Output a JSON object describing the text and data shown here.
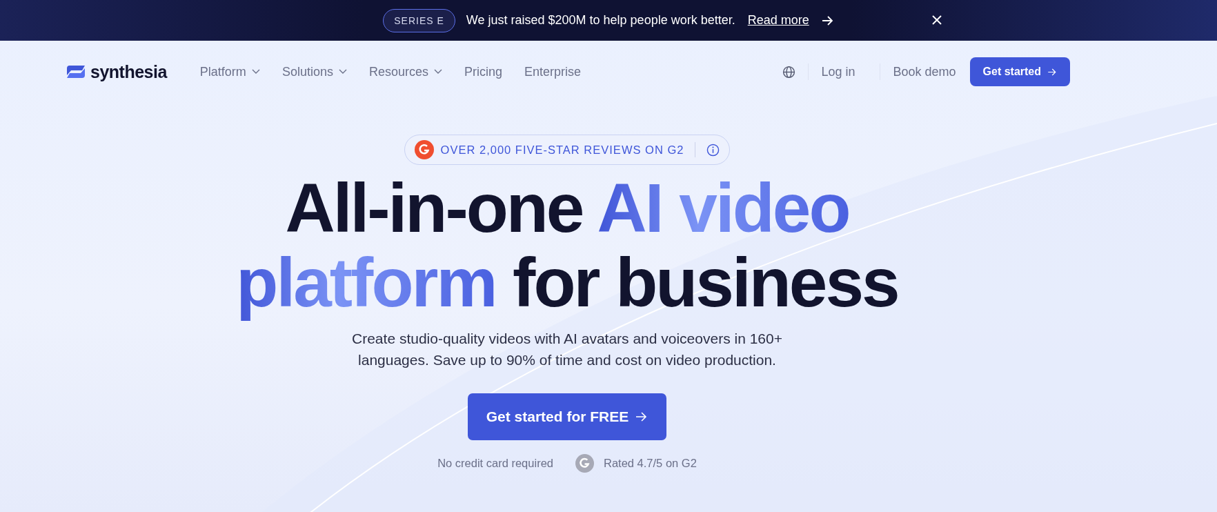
{
  "announcement": {
    "tag": "SERIES E",
    "message": "We just raised $200M to help people work better.",
    "link": "Read more"
  },
  "nav": {
    "logo": "synthesia",
    "items": [
      {
        "label": "Platform",
        "dropdown": true
      },
      {
        "label": "Solutions",
        "dropdown": true
      },
      {
        "label": "Resources",
        "dropdown": true
      },
      {
        "label": "Pricing",
        "dropdown": false
      },
      {
        "label": "Enterprise",
        "dropdown": false
      }
    ],
    "login": "Log in",
    "demo": "Book demo",
    "cta": "Get started"
  },
  "hero": {
    "badge": "OVER 2,000 FIVE-STAR REVIEWS ON G2",
    "headline": [
      [
        {
          "text": "All-in-one ",
          "highlight": false
        },
        {
          "text": "AI video",
          "highlight": true
        }
      ],
      [
        {
          "text": "platform",
          "highlight": true
        },
        {
          "text": " for business",
          "highlight": false
        }
      ]
    ],
    "subtitle": "Create studio-quality videos with AI avatars and voiceovers in 160+ languages. Save up to 90% of time and cost on video production.",
    "cta": "Get started for FREE",
    "note": "No credit card required",
    "rating": "Rated 4.7/5 on G2"
  }
}
